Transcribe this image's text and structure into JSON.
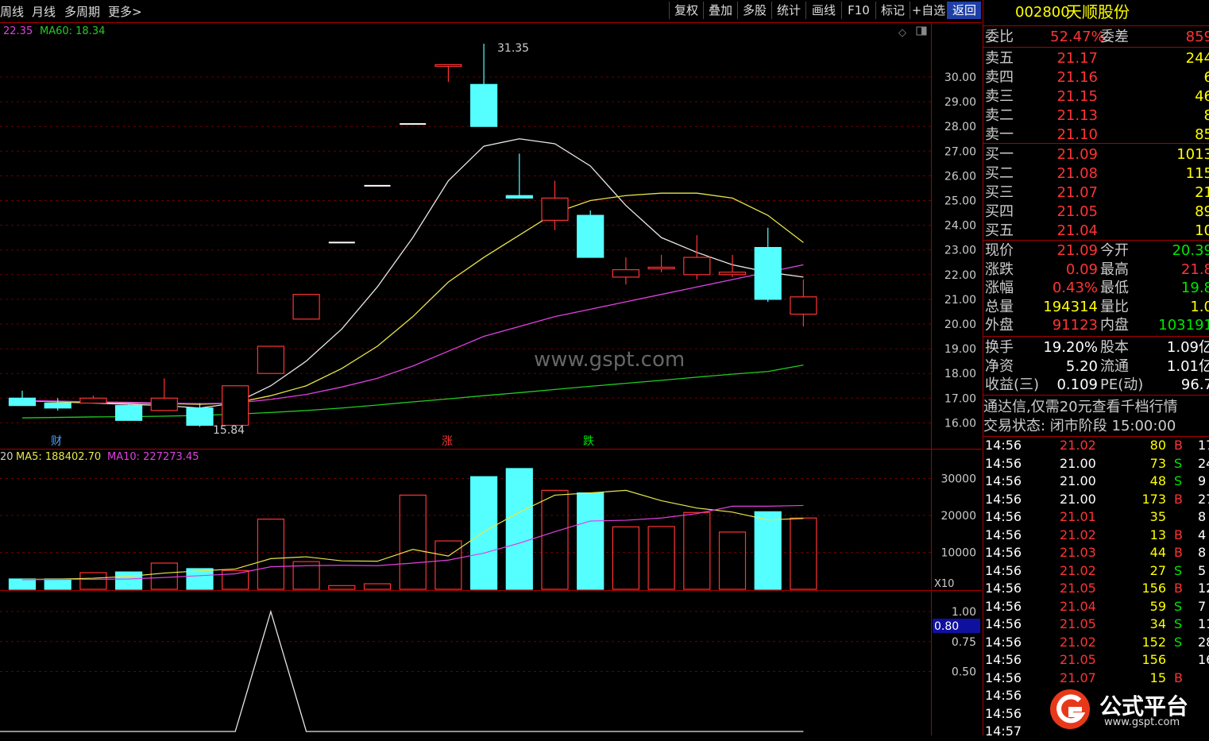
{
  "toolbar": {
    "left_tabs": [
      "周线",
      "月线",
      "多周期",
      "更多>"
    ],
    "right_buttons": [
      "复权",
      "叠加",
      "多股",
      "统计",
      "画线",
      "F10",
      "标记",
      "+自选",
      "返回"
    ]
  },
  "price_chart": {
    "ma_label_prefix": "22.35",
    "ma60_label": "MA60: 18.34",
    "y_ticks": [
      "30.00",
      "29.00",
      "28.00",
      "27.00",
      "26.00",
      "25.00",
      "24.00",
      "23.00",
      "22.00",
      "21.00",
      "20.00",
      "19.00",
      "18.00",
      "17.00",
      "16.00"
    ],
    "high_label": "31.35",
    "low_label": "15.84",
    "watermark": "www.gspt.com",
    "markers": [
      {
        "text": "财",
        "color": "#4aa0ff"
      },
      {
        "text": "涨",
        "color": "#ff3333"
      },
      {
        "text": "跌",
        "color": "#00e600"
      }
    ]
  },
  "volume_chart": {
    "label_prefix": "20",
    "ma5_label": "MA5: 188402.70",
    "ma10_label": "MA10: 227273.45",
    "y_ticks": [
      "30000",
      "20000",
      "10000"
    ],
    "unit": "X10"
  },
  "indicator_chart": {
    "y_ticks": [
      "1.00",
      "0.75",
      "0.50"
    ],
    "current_value": "0.80"
  },
  "chart_data": {
    "type": "candlestick",
    "candles": [
      {
        "open": 17.0,
        "close": 16.7,
        "high": 17.3,
        "low": 16.7
      },
      {
        "open": 16.8,
        "close": 16.6,
        "high": 17.0,
        "low": 16.5
      },
      {
        "open": 16.8,
        "close": 17.0,
        "high": 17.1,
        "low": 16.8
      },
      {
        "open": 16.7,
        "close": 16.1,
        "high": 16.8,
        "low": 16.1
      },
      {
        "open": 16.5,
        "close": 17.0,
        "high": 17.8,
        "low": 16.5
      },
      {
        "open": 16.6,
        "close": 15.9,
        "high": 16.8,
        "low": 15.84
      },
      {
        "open": 15.9,
        "close": 17.5,
        "high": 17.5,
        "low": 15.9
      },
      {
        "open": 18.0,
        "close": 19.1,
        "high": 19.1,
        "low": 18.0
      },
      {
        "open": 20.2,
        "close": 21.2,
        "high": 21.2,
        "low": 20.2
      },
      {
        "open": 23.3,
        "close": 23.3,
        "high": 23.3,
        "low": 23.3
      },
      {
        "open": 25.6,
        "close": 25.6,
        "high": 25.6,
        "low": 25.6
      },
      {
        "open": 28.1,
        "close": 28.1,
        "high": 28.1,
        "low": 28.1
      },
      {
        "open": 30.5,
        "close": 30.5,
        "high": 30.5,
        "low": 29.8
      },
      {
        "open": 29.7,
        "close": 28.0,
        "high": 31.35,
        "low": 28.0
      },
      {
        "open": 25.2,
        "close": 25.1,
        "high": 26.9,
        "low": 25.1
      },
      {
        "open": 24.2,
        "close": 25.1,
        "high": 25.8,
        "low": 23.8
      },
      {
        "open": 24.4,
        "close": 22.7,
        "high": 24.6,
        "low": 22.7
      },
      {
        "open": 21.9,
        "close": 22.2,
        "high": 22.7,
        "low": 21.6
      },
      {
        "open": 22.3,
        "close": 22.3,
        "high": 22.8,
        "low": 22.1
      },
      {
        "open": 22.0,
        "close": 22.7,
        "high": 23.6,
        "low": 21.8
      },
      {
        "open": 22.0,
        "close": 22.1,
        "high": 22.8,
        "low": 21.9
      },
      {
        "open": 23.1,
        "close": 21.0,
        "high": 23.9,
        "low": 20.9
      },
      {
        "open": 20.4,
        "close": 21.1,
        "high": 21.8,
        "low": 19.9
      }
    ],
    "ma_series": [
      {
        "color": "#e8e8e8",
        "values": [
          16.9,
          16.85,
          16.8,
          16.75,
          16.7,
          16.6,
          16.8,
          17.5,
          18.5,
          19.8,
          21.5,
          23.5,
          25.8,
          27.2,
          27.5,
          27.3,
          26.4,
          24.8,
          23.5,
          22.9,
          22.4,
          22.1,
          21.9
        ]
      },
      {
        "color": "#e6e64a",
        "values": [
          16.9,
          16.85,
          16.82,
          16.8,
          16.78,
          16.75,
          16.8,
          17.1,
          17.5,
          18.2,
          19.1,
          20.3,
          21.7,
          22.7,
          23.6,
          24.5,
          25.0,
          25.2,
          25.3,
          25.3,
          25.1,
          24.4,
          23.3
        ]
      },
      {
        "color": "#e040e0",
        "values": [
          16.9,
          16.88,
          16.85,
          16.83,
          16.8,
          16.78,
          16.8,
          16.95,
          17.15,
          17.45,
          17.8,
          18.3,
          18.9,
          19.5,
          19.9,
          20.3,
          20.6,
          20.9,
          21.2,
          21.5,
          21.8,
          22.1,
          22.4
        ]
      },
      {
        "color": "#22cc22",
        "values": [
          16.2,
          16.22,
          16.24,
          16.25,
          16.27,
          16.3,
          16.35,
          16.42,
          16.5,
          16.6,
          16.72,
          16.85,
          16.97,
          17.1,
          17.22,
          17.35,
          17.48,
          17.6,
          17.72,
          17.85,
          17.97,
          18.08,
          18.34
        ]
      }
    ],
    "volume": {
      "values": [
        2800,
        2800,
        4500,
        4700,
        7100,
        5600,
        5100,
        19000,
        7500,
        1000,
        1500,
        25500,
        13100,
        30500,
        32700,
        26800,
        26100,
        16900,
        17000,
        20800,
        15500,
        21000,
        19300
      ],
      "ma5": [
        2700,
        2750,
        3000,
        3500,
        4400,
        5000,
        5500,
        8300,
        8800,
        7700,
        7600,
        10800,
        9000,
        15600,
        20900,
        25500,
        26100,
        26800,
        24000,
        22000,
        20900,
        18800,
        19200
      ],
      "ma10": [
        2600,
        2650,
        2700,
        2800,
        3200,
        3700,
        4200,
        6100,
        6400,
        6500,
        6400,
        7100,
        7900,
        9800,
        12500,
        15600,
        18500,
        18700,
        19300,
        20500,
        22500,
        22500,
        22700
      ]
    },
    "indicator": {
      "values": [
        0,
        0,
        0,
        0,
        0,
        0,
        0,
        1,
        0,
        0,
        0,
        0,
        0,
        0,
        0,
        0,
        0,
        0,
        0,
        0,
        0,
        0,
        0
      ]
    }
  },
  "quote": {
    "code": "002800",
    "name": "天顺股份",
    "weibi_label": "委比",
    "weibi_value": "52.47%",
    "weicha_label": "委差",
    "weicha_value": "859",
    "sells": [
      {
        "label": "卖五",
        "price": "21.17",
        "vol": "244"
      },
      {
        "label": "卖四",
        "price": "21.16",
        "vol": "6"
      },
      {
        "label": "卖三",
        "price": "21.15",
        "vol": "46"
      },
      {
        "label": "卖二",
        "price": "21.13",
        "vol": "8"
      },
      {
        "label": "卖一",
        "price": "21.10",
        "vol": "85"
      }
    ],
    "buys": [
      {
        "label": "买一",
        "price": "21.09",
        "vol": "1013"
      },
      {
        "label": "买二",
        "price": "21.08",
        "vol": "115"
      },
      {
        "label": "买三",
        "price": "21.07",
        "vol": "21"
      },
      {
        "label": "买四",
        "price": "21.05",
        "vol": "89"
      },
      {
        "label": "买五",
        "price": "21.04",
        "vol": "10"
      }
    ],
    "stats": [
      {
        "l1": "现价",
        "v1": "21.09",
        "c1": "red",
        "l2": "今开",
        "v2": "20.39",
        "c2": "green"
      },
      {
        "l1": "涨跌",
        "v1": "0.09",
        "c1": "red",
        "l2": "最高",
        "v2": "21.8",
        "c2": "red"
      },
      {
        "l1": "涨幅",
        "v1": "0.43%",
        "c1": "red",
        "l2": "最低",
        "v2": "19.8",
        "c2": "green"
      },
      {
        "l1": "总量",
        "v1": "194314",
        "c1": "yellow",
        "l2": "量比",
        "v2": "1.0",
        "c2": "yellow"
      },
      {
        "l1": "外盘",
        "v1": "91123",
        "c1": "red",
        "l2": "内盘",
        "v2": "103191",
        "c2": "green"
      }
    ],
    "stats2": [
      {
        "l1": "换手",
        "v1": "19.20%",
        "l2": "股本",
        "v2": "1.09亿"
      },
      {
        "l1": "净资",
        "v1": "5.20",
        "l2": "流通",
        "v2": "1.01亿"
      },
      {
        "l1": "收益(三)",
        "v1": "0.109",
        "l2": "PE(动)",
        "v2": "96.7"
      }
    ],
    "promo": "通达信,仅需20元查看千档行情",
    "trade_status": "交易状态: 闭市阶段 15:00:00"
  },
  "ticks": [
    {
      "time": "14:56",
      "price": "21.02",
      "pc": "red",
      "vol": "80",
      "side": "B",
      "extra": "17"
    },
    {
      "time": "14:56",
      "price": "21.00",
      "pc": "white",
      "vol": "73",
      "side": "S",
      "extra": "24"
    },
    {
      "time": "14:56",
      "price": "21.00",
      "pc": "white",
      "vol": "48",
      "side": "S",
      "extra": "9"
    },
    {
      "time": "14:56",
      "price": "21.00",
      "pc": "white",
      "vol": "173",
      "side": "B",
      "extra": "27"
    },
    {
      "time": "14:56",
      "price": "21.01",
      "pc": "red",
      "vol": "35",
      "side": "",
      "extra": "8"
    },
    {
      "time": "14:56",
      "price": "21.02",
      "pc": "red",
      "vol": "13",
      "side": "B",
      "extra": "4"
    },
    {
      "time": "14:56",
      "price": "21.03",
      "pc": "red",
      "vol": "44",
      "side": "B",
      "extra": "8"
    },
    {
      "time": "14:56",
      "price": "21.02",
      "pc": "red",
      "vol": "27",
      "side": "S",
      "extra": "5"
    },
    {
      "time": "14:56",
      "price": "21.05",
      "pc": "red",
      "vol": "156",
      "side": "B",
      "extra": "12"
    },
    {
      "time": "14:56",
      "price": "21.04",
      "pc": "red",
      "vol": "59",
      "side": "S",
      "extra": "7"
    },
    {
      "time": "14:56",
      "price": "21.05",
      "pc": "red",
      "vol": "34",
      "side": "S",
      "extra": "11"
    },
    {
      "time": "14:56",
      "price": "21.02",
      "pc": "red",
      "vol": "152",
      "side": "S",
      "extra": "28"
    },
    {
      "time": "14:56",
      "price": "21.05",
      "pc": "red",
      "vol": "156",
      "side": "",
      "extra": "16"
    },
    {
      "time": "14:56",
      "price": "21.07",
      "pc": "red",
      "vol": "15",
      "side": "B",
      "extra": ""
    },
    {
      "time": "14:56",
      "price": "",
      "pc": "red",
      "vol": "",
      "side": "",
      "extra": ""
    },
    {
      "time": "14:56",
      "price": "",
      "pc": "red",
      "vol": "",
      "side": "",
      "extra": ""
    },
    {
      "time": "14:57",
      "price": "",
      "pc": "red",
      "vol": "",
      "side": "",
      "extra": ""
    }
  ],
  "logo": {
    "text": "公式平台",
    "url": "www.gspt.com"
  }
}
